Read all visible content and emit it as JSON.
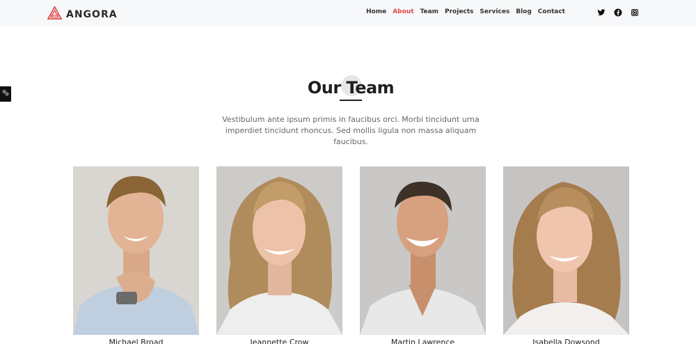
{
  "brand": {
    "name": "ANGORA",
    "accent": "#e04a4a"
  },
  "nav": [
    {
      "label": "Home",
      "active": false
    },
    {
      "label": "About",
      "active": true
    },
    {
      "label": "Team",
      "active": false
    },
    {
      "label": "Projects",
      "active": false
    },
    {
      "label": "Services",
      "active": false
    },
    {
      "label": "Blog",
      "active": false
    },
    {
      "label": "Contact",
      "active": false
    }
  ],
  "social_icons": [
    "twitter-icon",
    "facebook-icon",
    "instagram-icon"
  ],
  "section": {
    "title": "Our Team",
    "description": "Vestibulum ante ipsum primis in faucibus orci. Morbi tincidunt urna imperdiet tincidunt rhoncus. Sed mollis ligula non massa aliquam faucibus."
  },
  "team": [
    {
      "name": "Michael Broad"
    },
    {
      "name": "Jeannette Crow"
    },
    {
      "name": "Martin Lawrence"
    },
    {
      "name": "Isabella Dowsond"
    }
  ]
}
